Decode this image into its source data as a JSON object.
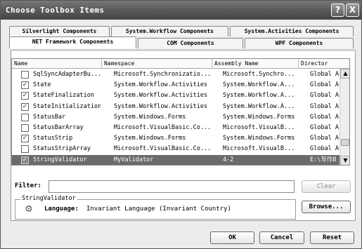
{
  "window": {
    "title": "Choose Toolbox Items"
  },
  "titlebar_buttons": {
    "help": "?",
    "close": "X"
  },
  "tabs": {
    "back": [
      "Silverlight Components",
      "System.Workflow Components",
      "System.Activities Components"
    ],
    "front": [
      "NET Framework Components",
      "COM Components",
      "WPF Components"
    ],
    "active": "NET Framework Components"
  },
  "list": {
    "columns": [
      "Name",
      "Namespace",
      "Assembly Name",
      "Director"
    ],
    "rows": [
      {
        "checked": false,
        "name": "SqlSyncAdapterBu...",
        "namespace": "Microsoft.Synchronizatio...",
        "assembly": "Microsoft.Synchro...",
        "directory": "Global A",
        "selected": false
      },
      {
        "checked": true,
        "name": "State",
        "namespace": "System.Workflow.Activities",
        "assembly": "System.Workflow.A...",
        "directory": "Global A",
        "selected": false
      },
      {
        "checked": true,
        "name": "StateFinalization",
        "namespace": "System.Workflow.Activities",
        "assembly": "System.Workflow.A...",
        "directory": "Global A",
        "selected": false
      },
      {
        "checked": true,
        "name": "StateInitialization",
        "namespace": "System.Workflow.Activities",
        "assembly": "System.Workflow.A...",
        "directory": "Global A",
        "selected": false
      },
      {
        "checked": false,
        "name": "StatusBar",
        "namespace": "System.Windows.Forms",
        "assembly": "System.Windows.Forms",
        "directory": "Global A",
        "selected": false
      },
      {
        "checked": false,
        "name": "StatusBarArray",
        "namespace": "Microsoft.VisualBasic.Co...",
        "assembly": "Microsoft.VisualB...",
        "directory": "Global A",
        "selected": false
      },
      {
        "checked": true,
        "name": "StatusStrip",
        "namespace": "System.Windows.Forms",
        "assembly": "System.Windows.Forms",
        "directory": "Global A",
        "selected": false
      },
      {
        "checked": false,
        "name": "StatusStripArray",
        "namespace": "Microsoft.VisualBasic.Co...",
        "assembly": "Microsoft.VisualB...",
        "directory": "Global A",
        "selected": false
      },
      {
        "checked": true,
        "name": "StringValidator",
        "namespace": "MyValidator",
        "assembly": "4-2",
        "directory": "E:\\写作B",
        "selected": true
      }
    ]
  },
  "filter": {
    "label": "Filter:",
    "value": "",
    "clear_label": "Clear"
  },
  "details": {
    "group_title": "StringValidator",
    "language_label": "Language:",
    "language_value": "Invariant Language (Invariant Country)",
    "browse_label": "Browse..."
  },
  "footer": {
    "ok_label": "OK",
    "cancel_label": "Cancel",
    "reset_label": "Reset"
  },
  "scrollbar": {
    "up": "▲",
    "down": "▼",
    "position": 0.86
  },
  "icons": {
    "checkbox_checked": "check-mark",
    "details": "gear-icon"
  }
}
